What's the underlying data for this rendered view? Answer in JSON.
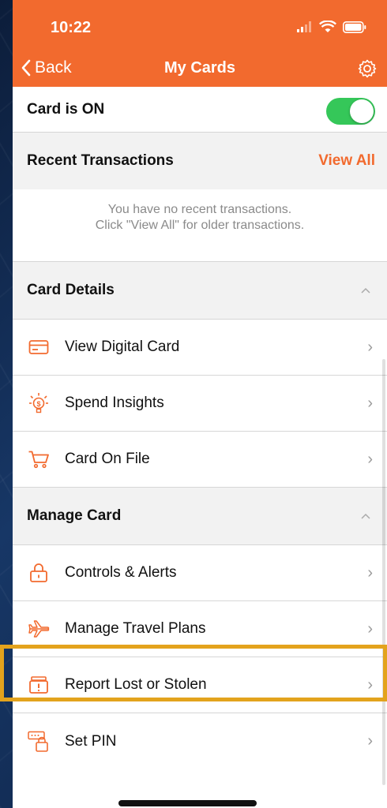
{
  "status": {
    "time": "10:22"
  },
  "nav": {
    "back_label": "Back",
    "title": "My Cards"
  },
  "card_status": {
    "label": "Card is ON",
    "enabled": true
  },
  "recent": {
    "title": "Recent Transactions",
    "view_all": "View All",
    "empty_line1": "You have no recent transactions.",
    "empty_line2": "Click \"View All\" for older transactions."
  },
  "card_details": {
    "title": "Card Details",
    "items": [
      {
        "label": "View Digital Card",
        "icon": "card-icon"
      },
      {
        "label": "Spend Insights",
        "icon": "insights-icon"
      },
      {
        "label": "Card On File",
        "icon": "cart-icon"
      }
    ]
  },
  "manage_card": {
    "title": "Manage Card",
    "items": [
      {
        "label": "Controls & Alerts",
        "icon": "lock-icon"
      },
      {
        "label": "Manage Travel Plans",
        "icon": "plane-icon"
      },
      {
        "label": "Report Lost or Stolen",
        "icon": "report-card-icon"
      },
      {
        "label": "Set PIN",
        "icon": "pin-icon"
      }
    ]
  },
  "colors": {
    "accent": "#f26a2e",
    "toggle_on": "#35c759",
    "highlight": "#e3a31d"
  }
}
